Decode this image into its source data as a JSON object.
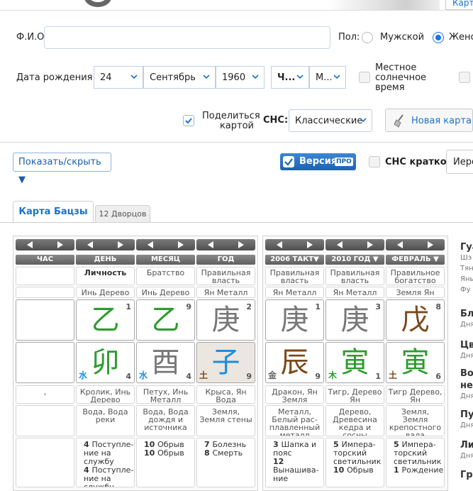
{
  "header": {
    "tab_label": "Карт"
  },
  "form": {
    "fio_label": "Ф.И.О.",
    "fio_value": "",
    "gender_label": "Пол:",
    "male_label": "Мужской",
    "female_label": "Женс",
    "gender_selected": "female",
    "birth_label": "Дата рождения",
    "day": "24",
    "month": "Сентябрь",
    "year": "1960",
    "hour": "Ч...",
    "minute": "М...",
    "solar_label_1": "Местное",
    "solar_label_2": "солнечное",
    "solar_label_3": "время",
    "share_label_1": "Поделиться",
    "share_label_2": "картой",
    "sns_label": "СНС:",
    "sns_value": "Классические",
    "new_map_label": "Новая карта"
  },
  "toolbar": {
    "show_hide": "Показать/скрыть ▼",
    "version_label": "Версия",
    "pro_badge": "ПРО",
    "sns_short_label": "СНС кратко",
    "hier_label": "Иеро"
  },
  "tabs": [
    {
      "label": "Карта Бацзы",
      "active": true
    },
    {
      "label": "12 Дворцов",
      "active": false
    }
  ],
  "chart": {
    "columns": [
      {
        "head": "ЧАС",
        "role": "",
        "role_elem": "",
        "stem": "",
        "stem_num": "",
        "branch": "",
        "branch_num": "",
        "animal": ",",
        "nayin": "",
        "palaces": []
      },
      {
        "head": "ДЕНЬ",
        "role": "Личность",
        "role_bold": true,
        "role_elem": "Инь Дерево",
        "stem": "乙",
        "stem_color": "green",
        "stem_num": "1",
        "branch": "卯",
        "branch_color": "green",
        "branch_num": "4",
        "branch_elem": "水",
        "branch_elem_type": "water",
        "animal": "Кролик, Инь Дерево",
        "nayin": "Вода, Вода реки",
        "palaces": [
          [
            "4",
            "Поступле- ние на службу"
          ],
          [
            "4",
            "Поступле- ние на службу"
          ]
        ]
      },
      {
        "head": "МЕСЯЦ",
        "role": "Братство",
        "role_elem": "Инь Дерево",
        "stem": "乙",
        "stem_color": "green",
        "stem_num": "9",
        "branch": "酉",
        "branch_color": "gray",
        "branch_num": "4",
        "branch_elem": "水",
        "branch_elem_type": "water",
        "animal": "Петух, Инь Металл",
        "nayin": "Вода, Вода дождя и источника",
        "palaces": [
          [
            "10",
            "Обрыв"
          ],
          [
            "10",
            "Обрыв"
          ]
        ]
      },
      {
        "head": "ГОД",
        "role": "Правильная власть",
        "role_elem": "Ян Металл",
        "stem": "庚",
        "stem_color": "gray",
        "stem_num": "2",
        "branch": "子",
        "branch_color": "blue",
        "branch_num": "9",
        "branch_elem": "土",
        "branch_elem_type": "earth",
        "shaded": true,
        "animal": "Крыса, Ян Вода",
        "nayin": "Земля, Земля стены",
        "palaces": [
          [
            "7",
            "Болезнь"
          ],
          [
            "8",
            "Смерть"
          ]
        ]
      }
    ],
    "luck_columns": [
      {
        "head": "2006 ТАКТ▼",
        "role": "Правильная власть",
        "role_elem": "Ян Металл",
        "stem": "庚",
        "stem_color": "gray",
        "stem_num": "1",
        "branch": "辰",
        "branch_color": "brown",
        "branch_num": "9",
        "branch_elem": "金",
        "branch_elem_type": "metal",
        "animal": "Дракон, Ян Земля",
        "nayin": "Металл, Белый рас- плавленный металл",
        "palaces": [
          [
            "3",
            "Шапка и пояс"
          ],
          [
            "12",
            "Вынашива- ние"
          ]
        ]
      },
      {
        "head": "2010 ГОД ▼",
        "role": "Правильная власть",
        "role_elem": "Ян Металл",
        "stem": "庚",
        "stem_color": "gray",
        "stem_num": "3",
        "branch": "寅",
        "branch_color": "green",
        "branch_num": "1",
        "branch_elem": "木",
        "branch_elem_type": "wood",
        "animal": "Тигр, Дерево Ян",
        "nayin": "Дерево, Древесина кедра и сосны",
        "palaces": [
          [
            "5",
            "Импера- торский светильник"
          ],
          [
            "10",
            "Обрыв"
          ]
        ]
      },
      {
        "head": "ФЕВРАЛЬ ▼",
        "role": "Правильное богатство",
        "role_elem": "Земля Ян",
        "stem": "戊",
        "stem_color": "brown",
        "stem_num": "8",
        "branch": "寅",
        "branch_color": "green",
        "branch_num": "6",
        "branch_elem": "土",
        "branch_elem_type": "earth",
        "animal": "Тигр Дерево, Ян",
        "nayin": "Земля, Земля крепостного вала",
        "palaces": [
          [
            "5",
            "Импера- торский светильник"
          ],
          [
            "1",
            "Рождение"
          ]
        ]
      }
    ]
  },
  "side": {
    "items": [
      {
        "title": "Гуа",
        "subs": [
          "Шэ",
          "Тян",
          "Янь",
          "Фу"
        ]
      },
      {
        "title": "Бл",
        "subs": [
          "Дня"
        ]
      },
      {
        "title": "Цв",
        "subs": [
          "Дня"
        ]
      },
      {
        "title": "Во",
        "title2": "не",
        "subs": [
          "Дня"
        ]
      },
      {
        "title": "Пу",
        "subs": [
          "Дня"
        ]
      },
      {
        "title": "Ли",
        "subs": [
          "Дня"
        ]
      },
      {
        "title": "Гра",
        "subs": []
      }
    ]
  }
}
